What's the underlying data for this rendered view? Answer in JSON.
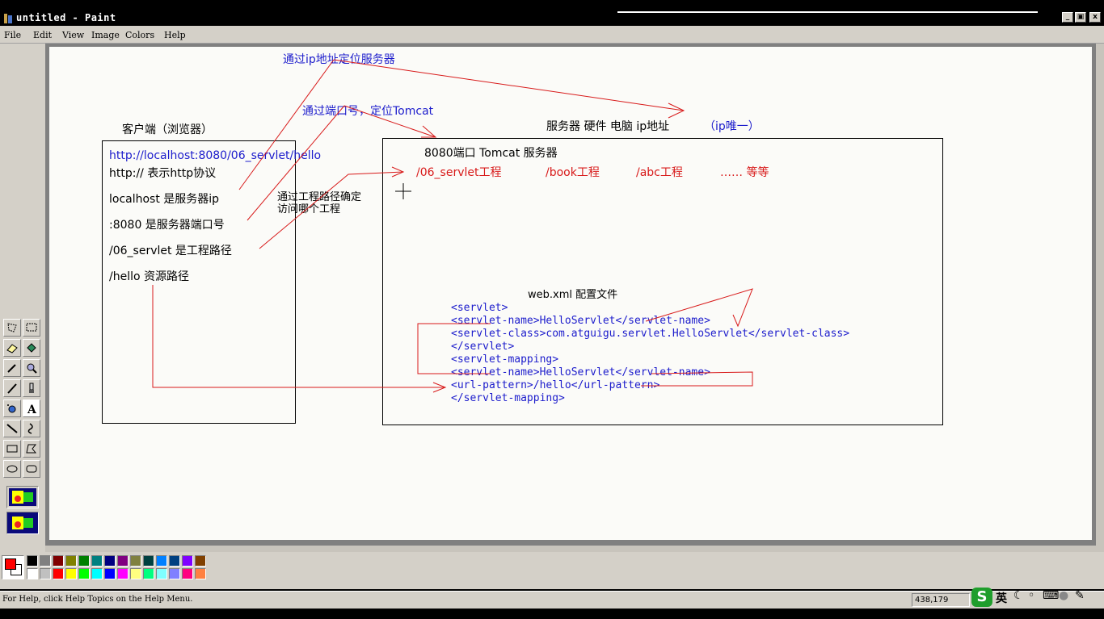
{
  "window": {
    "title": "untitled - Paint",
    "min_label": "_",
    "restore_label": "2",
    "close_label": "x"
  },
  "menu": [
    "File",
    "Edit",
    "View",
    "Image",
    "Colors",
    "Help"
  ],
  "canvas_text": {
    "loc_ip": "通过ip地址定位服务器",
    "loc_port": "通过端口号，定位Tomcat",
    "client_title": "客户端（浏览器）",
    "server_title": "服务器 硬件 电脑  ip地址",
    "server_title_note": "（ip唯一）",
    "url": "http://localhost:8080/06_servlet/hello",
    "proto": "http:// 表示http协议",
    "host": "localhost 是服务器ip",
    "port": ":8080 是服务器端口号",
    "path": "/06_servlet 是工程路径",
    "res": "/hello  资源路径",
    "by_path_1": "通过工程路径确定",
    "by_path_2": "访问哪个工程",
    "tomcat": "8080端口 Tomcat 服务器",
    "proj1": "/06_servlet工程",
    "proj2": "/book工程",
    "proj3": "/abc工程",
    "proj4": "…… 等等",
    "webxml_title": "web.xml 配置文件",
    "xml": [
      "<servlet>",
      "    <servlet-name>HelloServlet</servlet-name>",
      "    <servlet-class>com.atguigu.servlet.HelloServlet</servlet-class>",
      "</servlet>",
      "<servlet-mapping>",
      "    <servlet-name>HelloServlet</servlet-name>",
      "    <url-pattern>/hello</url-pattern>",
      "</servlet-mapping>"
    ]
  },
  "palette_colors": [
    "#000000",
    "#808080",
    "#800000",
    "#808000",
    "#008000",
    "#008080",
    "#000080",
    "#800080",
    "#808040",
    "#004040",
    "#0080ff",
    "#004080",
    "#8000ff",
    "#804000",
    "#ffffff",
    "#c0c0c0",
    "#ff0000",
    "#ffff00",
    "#00ff00",
    "#00ffff",
    "#0000ff",
    "#ff00ff",
    "#ffff80",
    "#00ff80",
    "#80ffff",
    "#8080ff",
    "#ff0080",
    "#ff8040"
  ],
  "current_fg": "#ff0000",
  "current_bg": "#ffffff",
  "status": {
    "message": "For Help, click Help Topics on the Help Menu.",
    "coords": "438,179"
  },
  "ime": {
    "logo": "S",
    "lang": "英"
  }
}
